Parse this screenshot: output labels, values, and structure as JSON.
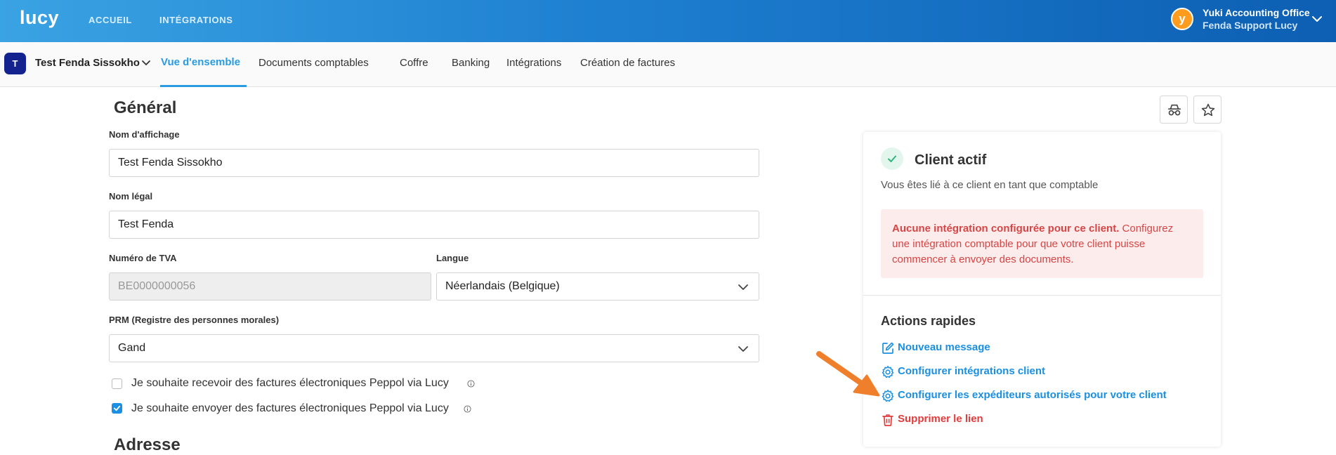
{
  "header": {
    "logo": "lucy",
    "nav": [
      "ACCUEIL",
      "INTÉGRATIONS"
    ],
    "account": {
      "avatar_letter": "y",
      "name": "Yuki Accounting Office",
      "subtitle": "Fenda Support Lucy"
    }
  },
  "client_bar": {
    "badge": "T",
    "client_name": "Test Fenda Sissokho",
    "tabs": [
      "Vue d'ensemble",
      "Documents comptables",
      "Coffre",
      "Banking",
      "Intégrations",
      "Création de factures"
    ],
    "active_tab": "Vue d'ensemble"
  },
  "general": {
    "title": "Général",
    "display_name_label": "Nom d'affichage",
    "display_name_value": "Test Fenda Sissokho",
    "legal_name_label": "Nom légal",
    "legal_name_value": "Test Fenda",
    "vat_label": "Numéro de TVA",
    "vat_placeholder": "BE0000000056",
    "language_label": "Langue",
    "language_value": "Néerlandais (Belgique)",
    "prm_label": "PRM (Registre des personnes morales)",
    "prm_value": "Gand",
    "checkbox_receive": {
      "label": "Je souhaite recevoir des factures électroniques Peppol via Lucy",
      "checked": false
    },
    "checkbox_send": {
      "label": "Je souhaite envoyer des factures électroniques Peppol via Lucy",
      "checked": true
    }
  },
  "address": {
    "title": "Adresse"
  },
  "status_card": {
    "title": "Client actif",
    "description": "Vous êtes lié à ce client en tant que comptable",
    "alert_bold": "Aucune intégration configurée pour ce client.",
    "alert_text": " Configurez une intégration comptable pour que votre client puisse commencer à envoyer des documents.",
    "quick_actions_title": "Actions rapides",
    "actions": [
      {
        "label": "Nouveau message",
        "icon": "edit-icon"
      },
      {
        "label": "Configurer intégrations client",
        "icon": "gear-icon"
      },
      {
        "label": "Configurer les expéditeurs autorisés pour votre client",
        "icon": "gear-icon"
      },
      {
        "label": "Supprimer le lien",
        "icon": "trash-icon"
      }
    ]
  },
  "colors": {
    "accent": "#2a9be0",
    "danger": "#e33b3b",
    "client_badge": "#14228f",
    "arrow": "#f07f2c"
  }
}
